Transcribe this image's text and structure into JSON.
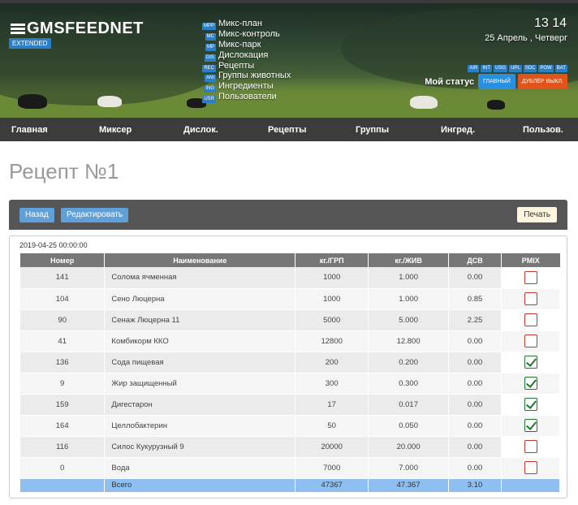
{
  "app": {
    "logo_text": "GMSFEEDNET",
    "edition": "EXTENDED"
  },
  "modules": [
    {
      "tag": "MPP",
      "label": "Микс-план"
    },
    {
      "tag": "MC",
      "label": "Микс-контроль"
    },
    {
      "tag": "MP",
      "label": "Микс-парк"
    },
    {
      "tag": "DIS",
      "label": "Дислокация"
    },
    {
      "tag": "REC",
      "label": "Рецепты"
    },
    {
      "tag": "ANI",
      "label": "Группы животных"
    },
    {
      "tag": "ING",
      "label": "Ингредиенты"
    },
    {
      "tag": "USR",
      "label": "Пользователи"
    }
  ],
  "clock": {
    "time": "13 14",
    "date": "25 Апрель , Четверг"
  },
  "status_tags": [
    "AIR",
    "INT",
    "USG",
    "UPL",
    "SDC",
    "POW",
    "BAT"
  ],
  "status": {
    "label": "Мой статус",
    "main_button": "ГЛАВНЫЙ",
    "dup_button": "ДУБЛЁР ВЫКЛ."
  },
  "nav": [
    "Главная",
    "Миксер",
    "Дислок.",
    "Рецепты",
    "Группы",
    "Ингред.",
    "Пользов."
  ],
  "page": {
    "title": "Рецепт №1",
    "back_button": "Назад",
    "edit_button": "Редактировать",
    "print_button": "Печать",
    "timestamp": "2019-04-25 00:00:00"
  },
  "table": {
    "headers": [
      "Номер",
      "Наименование",
      "кг./ГРП",
      "кг./ЖИВ",
      "ДСВ",
      "PMIX"
    ],
    "rows": [
      {
        "num": "141",
        "name": "Солома ячменная",
        "kg_grp": "1000",
        "kg_zhiv": "1.000",
        "dsv": "0.00",
        "pmix": false
      },
      {
        "num": "104",
        "name": "Сено Люцерна",
        "kg_grp": "1000",
        "kg_zhiv": "1.000",
        "dsv": "0.85",
        "pmix": false
      },
      {
        "num": "90",
        "name": "Сенаж Люцерна 11",
        "kg_grp": "5000",
        "kg_zhiv": "5.000",
        "dsv": "2.25",
        "pmix": false
      },
      {
        "num": "41",
        "name": "Комбикорм ККО",
        "kg_grp": "12800",
        "kg_zhiv": "12.800",
        "dsv": "0.00",
        "pmix": false
      },
      {
        "num": "136",
        "name": "Сода пищевая",
        "kg_grp": "200",
        "kg_zhiv": "0.200",
        "dsv": "0.00",
        "pmix": true
      },
      {
        "num": "9",
        "name": "Жир защищенный",
        "kg_grp": "300",
        "kg_zhiv": "0.300",
        "dsv": "0.00",
        "pmix": true
      },
      {
        "num": "159",
        "name": "Дигестарон",
        "kg_grp": "17",
        "kg_zhiv": "0.017",
        "dsv": "0.00",
        "pmix": true
      },
      {
        "num": "164",
        "name": "Целлобактерин",
        "kg_grp": "50",
        "kg_zhiv": "0.050",
        "dsv": "0.00",
        "pmix": true
      },
      {
        "num": "116",
        "name": "Силос Кукурузный 9",
        "kg_grp": "20000",
        "kg_zhiv": "20.000",
        "dsv": "0.00",
        "pmix": false
      },
      {
        "num": "0",
        "name": "Вода",
        "kg_grp": "7000",
        "kg_zhiv": "7.000",
        "dsv": "0.00",
        "pmix": false
      }
    ],
    "total": {
      "label": "Всего",
      "kg_grp": "47367",
      "kg_zhiv": "47.367",
      "dsv": "3.10"
    }
  },
  "colors": {
    "accent_blue": "#2b7fc7",
    "button_blue": "#5fa0d8",
    "dup_orange": "#e0541b",
    "total_row": "#8dbff0",
    "check_on": "#1a7a2e",
    "check_off": "#c0392b"
  }
}
